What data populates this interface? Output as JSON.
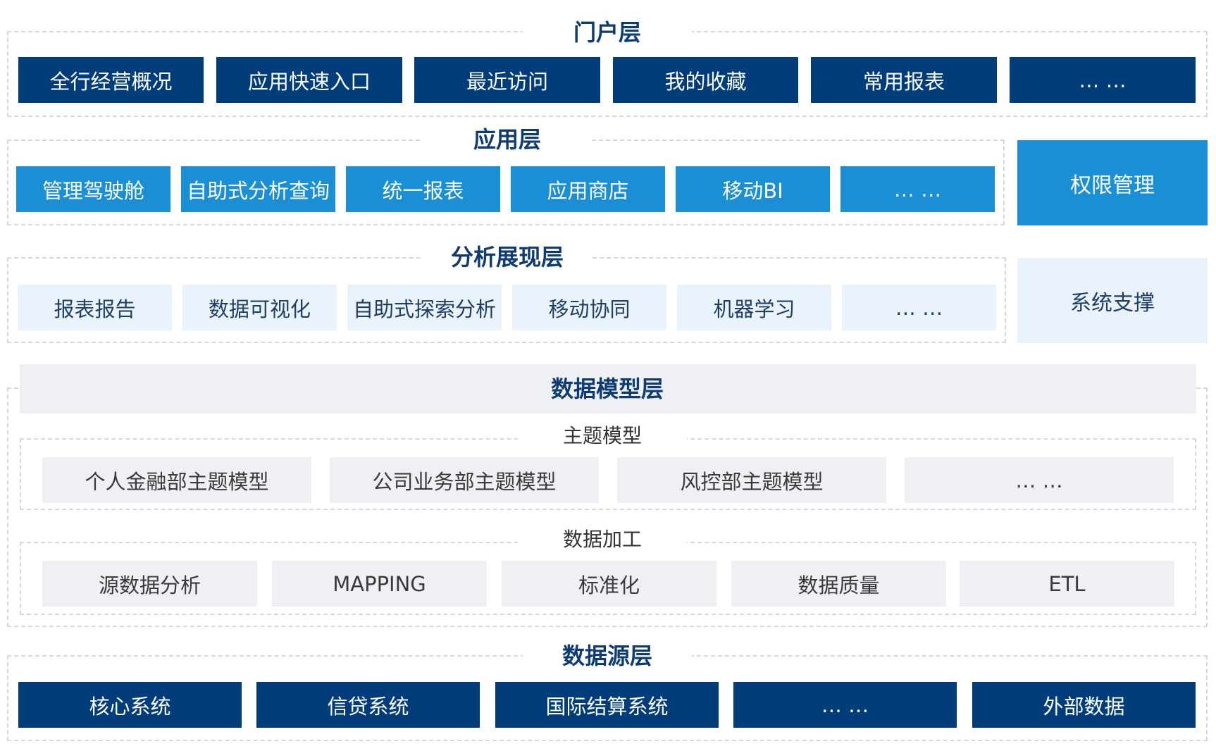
{
  "portal": {
    "title": "门户层",
    "items": [
      "全行经营概况",
      "应用快速入口",
      "最近访问",
      "我的收藏",
      "常用报表",
      "… …"
    ]
  },
  "application": {
    "title": "应用层",
    "items": [
      "管理驾驶舱",
      "自助式分析查询",
      "统一报表",
      "应用商店",
      "移动BI",
      "… …"
    ],
    "side": "权限管理"
  },
  "analysis": {
    "title": "分析展现层",
    "items": [
      "报表报告",
      "数据可视化",
      "自助式探索分析",
      "移动协同",
      "机器学习",
      "… …"
    ],
    "side": "系统支撑"
  },
  "datamodel": {
    "title": "数据模型层",
    "topic": {
      "title": "主题模型",
      "items": [
        "个人金融部主题模型",
        "公司业务部主题模型",
        "风控部主题模型",
        "… …"
      ]
    },
    "processing": {
      "title": "数据加工",
      "items": [
        "源数据分析",
        "MAPPING",
        "标准化",
        "数据质量",
        "ETL"
      ]
    }
  },
  "datasource": {
    "title": "数据源层",
    "items": [
      "核心系统",
      "信贷系统",
      "国际结算系统",
      "… …",
      "外部数据"
    ]
  },
  "colors": {
    "dark_navy": "#003d7a",
    "bright_blue": "#1a8fd5",
    "pale_blue": "#eaf2fb",
    "light_gray": "#eef0f3",
    "title_navy": "#0d3b72"
  }
}
